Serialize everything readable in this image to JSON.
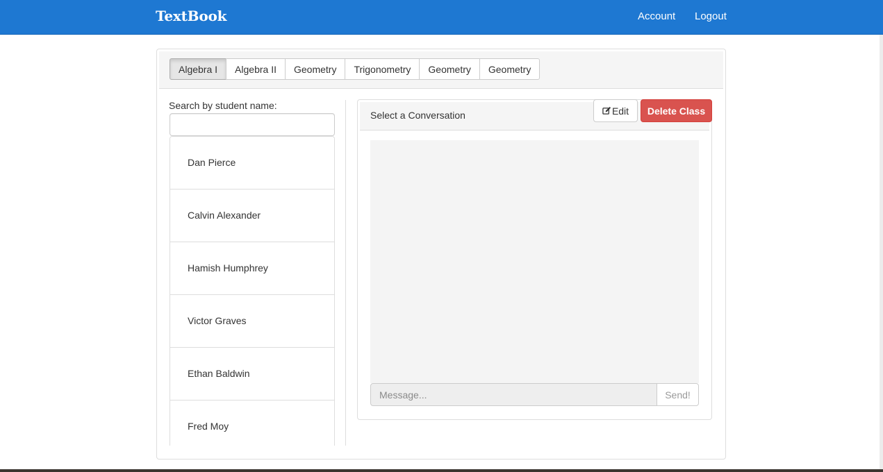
{
  "navbar": {
    "brand": "TextBook",
    "links": [
      {
        "label": "Account"
      },
      {
        "label": "Logout"
      }
    ],
    "color": "#1e78d2"
  },
  "class_tabs": [
    {
      "label": "Algebra I",
      "active": true
    },
    {
      "label": "Algebra II",
      "active": false
    },
    {
      "label": "Geometry",
      "active": false
    },
    {
      "label": "Trigonometry",
      "active": false
    },
    {
      "label": "Geometry",
      "active": false
    },
    {
      "label": "Geometry",
      "active": false
    }
  ],
  "search": {
    "label": "Search by student name:",
    "value": ""
  },
  "students": [
    {
      "name": "Dan Pierce"
    },
    {
      "name": "Calvin Alexander"
    },
    {
      "name": "Hamish Humphrey"
    },
    {
      "name": "Victor Graves"
    },
    {
      "name": "Ethan Baldwin"
    },
    {
      "name": "Fred Moy"
    }
  ],
  "conversation": {
    "title": "Select a Conversation",
    "edit_label": "Edit",
    "edit_icon": "edit-icon",
    "delete_label": "Delete Class",
    "delete_color": "#d9534f",
    "message_placeholder": "Message...",
    "send_label": "Send!"
  }
}
